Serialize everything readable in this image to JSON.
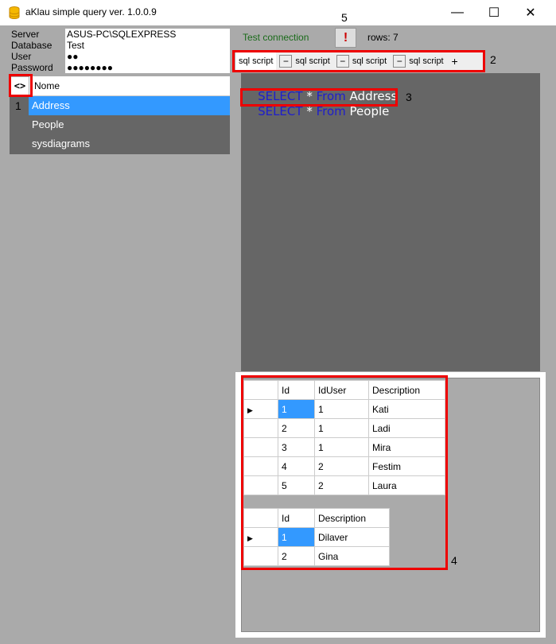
{
  "window": {
    "title": "aKlau simple query ver. 1.0.0.9",
    "min_label": "—",
    "max_label": "☐",
    "close_label": "✕"
  },
  "connection": {
    "server_label": "Server",
    "server_value": "ASUS-PC\\SQLEXPRESS",
    "database_label": "Database",
    "database_value": "Test",
    "user_label": "User",
    "user_value": "●●",
    "password_label": "Password",
    "password_value": "●●●●●●●●"
  },
  "tables_panel": {
    "toggle_label": "<>",
    "header": "Nome",
    "items": [
      "Address",
      "People",
      "sysdiagrams"
    ],
    "selected_index": 0
  },
  "toolbar": {
    "test_connection": "Test connection",
    "error_label": "!",
    "rows": "rows: 7"
  },
  "tabs": {
    "items": [
      "sql script",
      "sql script",
      "sql script",
      "sql script"
    ],
    "close_label": "−",
    "add_label": "+"
  },
  "editor": {
    "lines": [
      {
        "kw1": "SELECT",
        "op": " * ",
        "kw2": "From",
        "name": " Address"
      },
      {
        "kw1": "SELECT",
        "op": " * ",
        "kw2": "From",
        "name": " People"
      }
    ]
  },
  "results": {
    "grid1": {
      "columns": [
        "Id",
        "IdUser",
        "Description"
      ],
      "rows": [
        [
          "1",
          "1",
          "Kati"
        ],
        [
          "2",
          "1",
          "Ladi"
        ],
        [
          "3",
          "1",
          "Mira"
        ],
        [
          "4",
          "2",
          "Festim"
        ],
        [
          "5",
          "2",
          "Laura"
        ]
      ]
    },
    "grid2": {
      "columns": [
        "Id",
        "Description"
      ],
      "rows": [
        [
          "1",
          "Dilaver"
        ],
        [
          "2",
          "Gina"
        ]
      ]
    },
    "row_marker": "▶"
  },
  "annotations": {
    "n1": "1",
    "n2": "2",
    "n3": "3",
    "n4": "4",
    "n5": "5"
  },
  "colors": {
    "accent": "#3399ff",
    "annotation": "#ee0000",
    "keyword": "#1e1ecc",
    "ok": "#1a6b1a"
  }
}
